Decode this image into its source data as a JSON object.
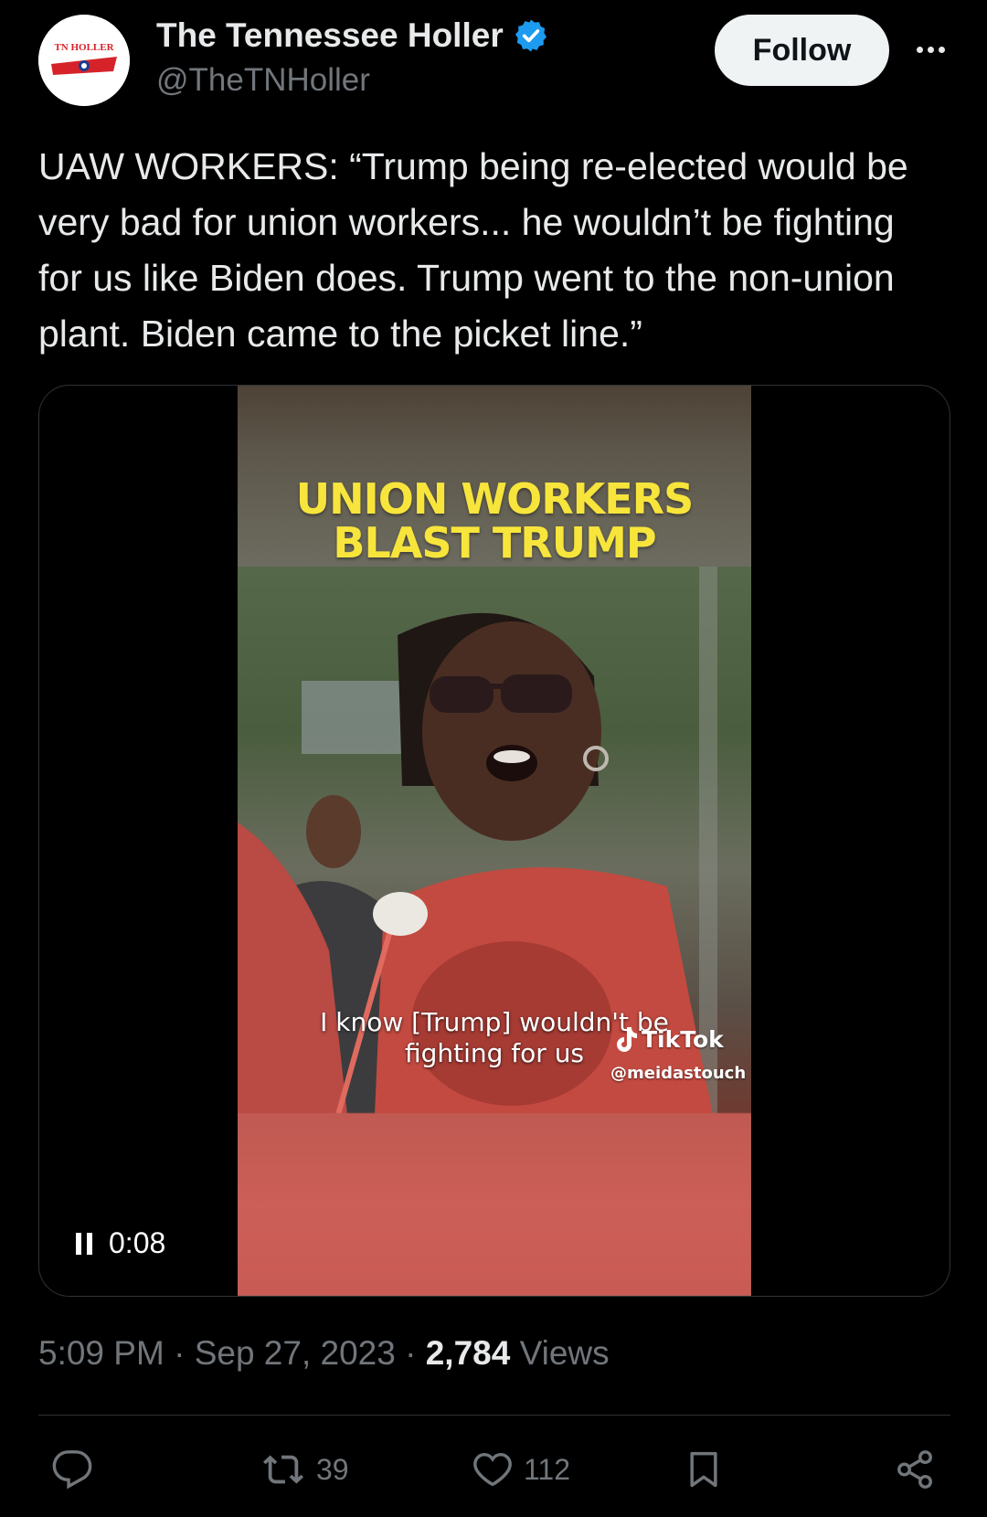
{
  "author": {
    "display_name": "The Tennessee Holler",
    "handle": "@TheTNHoller",
    "avatar_logo_text": "TN HOLLER",
    "verified_icon": "verified-badge-icon"
  },
  "header": {
    "follow_label": "Follow",
    "more_icon": "more-dots-icon"
  },
  "tweet": {
    "text": "UAW WORKERS: “Trump being re-elected would be\nvery bad for union workers... he wouldn’t be fighting\nfor us like Biden does. Trump went to the non-union\nplant. Biden came to the picket line.”"
  },
  "video": {
    "title_overlay": "UNION WORKERS\nBLAST TRUMP",
    "caption": "I know [Trump] wouldn't be\nfighting for us",
    "watermark_brand": "TikTok",
    "watermark_handle": "@meidastouch",
    "elapsed": "0:08",
    "state": "playing"
  },
  "meta": {
    "time": "5:09 PM",
    "date": "Sep 27, 2023",
    "separator": "·",
    "views_count": "2,784",
    "views_label": "Views"
  },
  "actions": {
    "reply_count": "",
    "retweet_count": "39",
    "like_count": "112"
  },
  "colors": {
    "background": "#000000",
    "text_primary": "#e7e9ea",
    "text_secondary": "#71767b",
    "verified": "#1d9bf0",
    "overlay_title": "#f7e53c"
  }
}
